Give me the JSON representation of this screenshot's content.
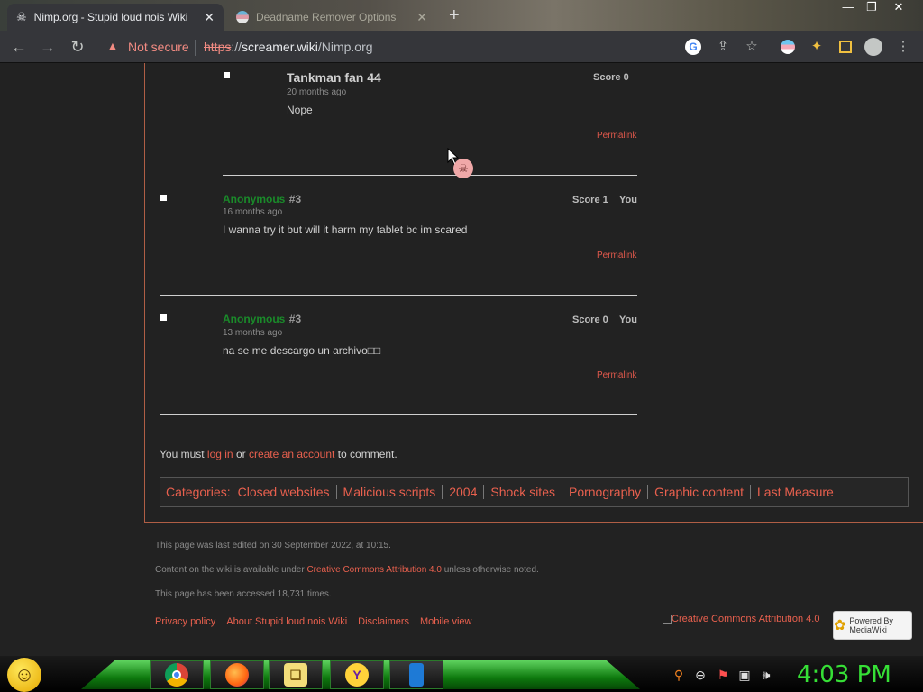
{
  "browser": {
    "tabs": [
      {
        "title": "Nimp.org - Stupid loud nois Wiki",
        "close": "✕"
      },
      {
        "title": "Deadname Remover Options",
        "close": "✕"
      }
    ],
    "new_tab": "+",
    "security_label": "Not secure",
    "url": {
      "scheme": "https",
      "sep": "://",
      "host": "screamer.wiki",
      "path": "/Nimp.org"
    }
  },
  "comments": [
    {
      "author": "Tankman fan 44",
      "number": "",
      "time": "20 months ago",
      "text": "Nope",
      "score": "Score 0",
      "you": "",
      "permalink": "Permalink"
    },
    {
      "author": "Anonymous",
      "number": "#3",
      "time": "16 months ago",
      "text": "I wanna try it but will it harm my tablet bc im scared",
      "score": "Score 1",
      "you": "You",
      "permalink": "Permalink"
    },
    {
      "author": "Anonymous",
      "number": "#3",
      "time": "13 months ago",
      "text": "na se me descargo un archivo□□",
      "score": "Score 0",
      "you": "You",
      "permalink": "Permalink"
    }
  ],
  "login_prompt": {
    "prefix": "You must ",
    "login": "log in",
    "middle": " or ",
    "create": "create an account",
    "suffix": " to comment."
  },
  "categories": {
    "label": "Categories:",
    "items": [
      "Closed websites",
      "Malicious scripts",
      "2004",
      "Shock sites",
      "Pornography",
      "Graphic content",
      "Last Measure"
    ]
  },
  "footer": {
    "last_edited": "This page was last edited on 30 September 2022, at 10:15.",
    "license_prefix": "Content on the wiki is available under ",
    "license_link": "Creative Commons Attribution 4.0",
    "license_suffix": " unless otherwise noted.",
    "accessed": "This page has been accessed 18,731 times.",
    "links": [
      "Privacy policy",
      "About Stupid loud nois Wiki",
      "Disclaimers",
      "Mobile view"
    ],
    "cc_image_alt": "Creative Commons Attribution 4.0",
    "mediawiki_badge": "Powered By MediaWiki"
  },
  "taskbar": {
    "apps": [
      "chrome-icon",
      "firefox-icon",
      "explorer-icon",
      "yahoo-messenger-icon",
      "phone-icon"
    ],
    "clock": "4:03 PM"
  }
}
